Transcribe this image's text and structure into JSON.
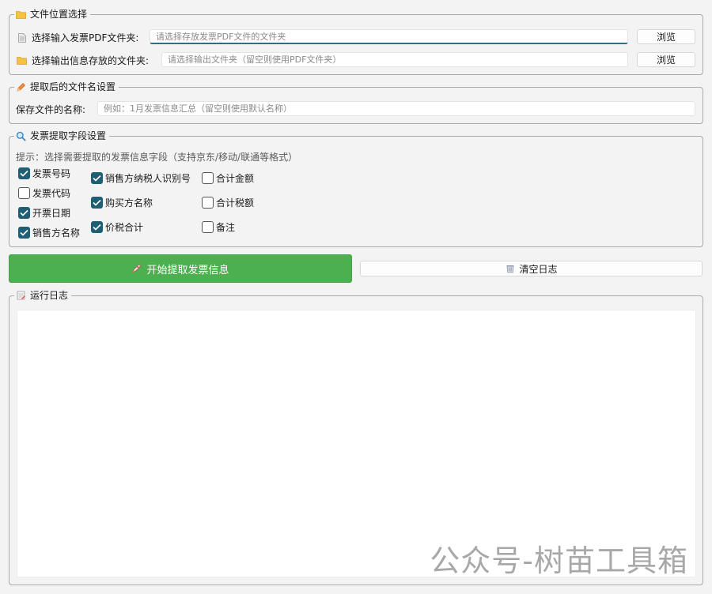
{
  "file_location": {
    "title": "文件位置选择",
    "input_label": "选择输入发票PDF文件夹:",
    "input_placeholder": "请选择存放发票PDF文件的文件夹",
    "input_value": "",
    "output_label": "选择输出信息存放的文件夹:",
    "output_placeholder": "请选择输出文件夹（留空则使用PDF文件夹）",
    "output_value": "",
    "browse_label": "浏览"
  },
  "filename_settings": {
    "title": "提取后的文件名设置",
    "name_label": "保存文件的名称:",
    "name_placeholder": "例如：1月发票信息汇总（留空则使用默认名称）",
    "name_value": ""
  },
  "fields": {
    "title": "发票提取字段设置",
    "hint": "提示：选择需要提取的发票信息字段（支持京东/移动/联通等格式）",
    "columns": [
      [
        {
          "label": "发票号码",
          "checked": true
        },
        {
          "label": "发票代码",
          "checked": false
        },
        {
          "label": "开票日期",
          "checked": true
        },
        {
          "label": "销售方名称",
          "checked": true
        }
      ],
      [
        {
          "label": "销售方纳税人识别号",
          "checked": true
        },
        {
          "label": "购买方名称",
          "checked": true
        },
        {
          "label": "价税合计",
          "checked": true
        }
      ],
      [
        {
          "label": "合计金额",
          "checked": false
        },
        {
          "label": "合计税额",
          "checked": false
        },
        {
          "label": "备注",
          "checked": false
        }
      ]
    ]
  },
  "actions": {
    "start_label": "开始提取发票信息",
    "clear_label": "清空日志"
  },
  "log": {
    "title": "运行日志",
    "content": ""
  },
  "watermark": "公众号-树苗工具箱",
  "colors": {
    "accent": "#4caf50",
    "checkbox": "#1e5f74",
    "folder": "#f5c342"
  },
  "icons": {
    "folder": "folder-icon",
    "document": "document-icon",
    "pencil": "pencil-icon",
    "search": "search-icon",
    "rocket": "rocket-icon",
    "trash": "trash-icon",
    "memo": "memo-icon"
  }
}
